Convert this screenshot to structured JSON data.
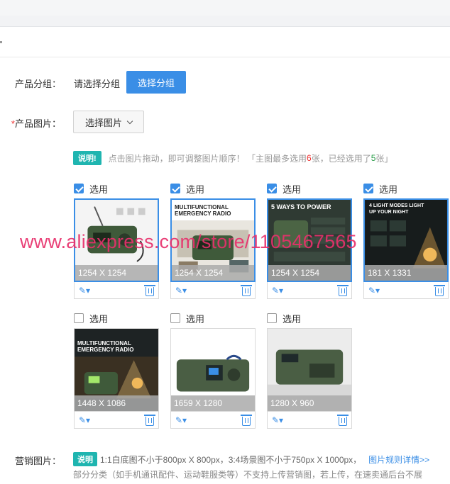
{
  "group": {
    "label": "产品分组：",
    "placeholder": "请选择分组",
    "button": "选择分组"
  },
  "images": {
    "label": "产品图片：",
    "required_mark": "*",
    "select_button": "选择图片",
    "tip_badge": "说明!",
    "tip_text_a": "点击图片拖动，即可调整图片顺序！ 「主图最多选用",
    "tip_max": "6",
    "tip_text_b": "张，已经选用了",
    "tip_used": "5",
    "tip_text_c": "张」",
    "check_label": "选用",
    "items": [
      {
        "size": "1254 X 1254",
        "checked": true,
        "banner": ""
      },
      {
        "size": "1254 X 1254",
        "checked": true,
        "banner": "MULTIFUNCTIONAL EMERGENCY RADIO"
      },
      {
        "size": "1254 X 1254",
        "checked": true,
        "banner": "5 WAYS TO POWER"
      },
      {
        "size": "181 X 1331",
        "checked": true,
        "banner": "4 LIGHT MODES LIGHT UP YOUR NIGHT"
      },
      {
        "size": "1448 X 1086",
        "checked": false,
        "banner": "MULTIFUNCTIONAL EMERGENCY RADIO"
      },
      {
        "size": "1659 X 1280",
        "checked": false,
        "banner": ""
      },
      {
        "size": "1280 X 960",
        "checked": false,
        "banner": ""
      }
    ]
  },
  "watermark": "www.aliexpress.com/store/1105467565",
  "marketing": {
    "label": "营销图片：",
    "badge": "说明",
    "line1": "1:1白底图不小于800px X 800px，3:4场景图不小于750px X 1000px，",
    "link": "图片规则详情>>",
    "line2": "部分分类（如手机通讯配件、运动鞋服类等）不支持上传营销图，若上传，在速卖通后台不展"
  },
  "colors": {
    "accent": "#3a8ee6",
    "teal": "#1fb5b0",
    "watermark": "#e8306c"
  }
}
